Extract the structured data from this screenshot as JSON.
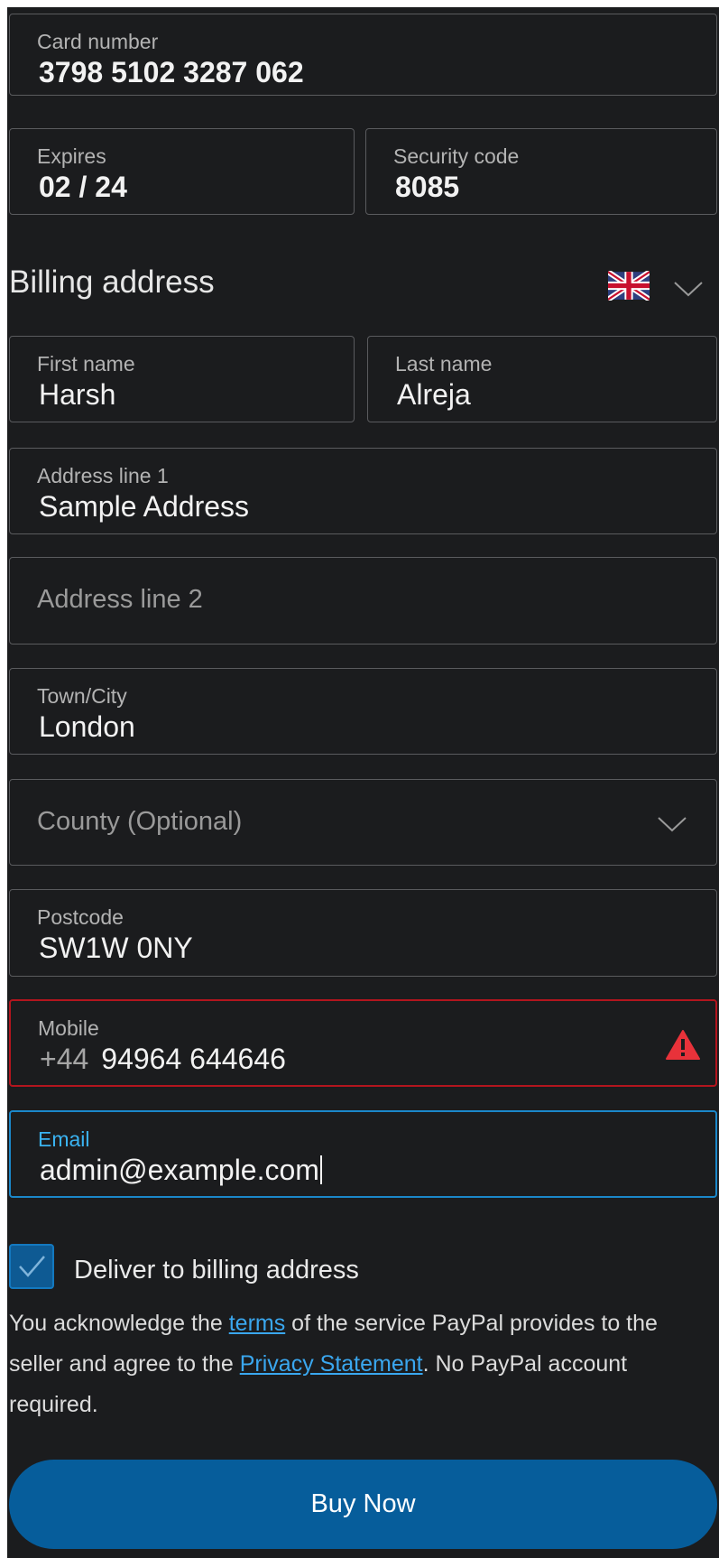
{
  "card": {
    "number_label": "Card number",
    "number_value": "3798 5102 3287 062",
    "expires_label": "Expires",
    "expires_value": "02 / 24",
    "security_label": "Security code",
    "security_value": "8085"
  },
  "billing": {
    "title": "Billing address",
    "country_flag_icon": "uk-flag-icon",
    "first_name_label": "First name",
    "first_name_value": "Harsh",
    "last_name_label": "Last name",
    "last_name_value": "Alreja",
    "address1_label": "Address line 1",
    "address1_value": "Sample Address",
    "address2_placeholder": "Address line 2",
    "city_label": "Town/City",
    "city_value": "London",
    "county_placeholder": "County (Optional)",
    "postcode_label": "Postcode",
    "postcode_value": "SW1W 0NY",
    "mobile_label": "Mobile",
    "mobile_prefix": "+44",
    "mobile_value": "94964 644646",
    "email_label": "Email",
    "email_value": "admin@example.com"
  },
  "delivery": {
    "checkbox_checked": true,
    "label": "Deliver to billing address"
  },
  "legal": {
    "part1": "You acknowledge the ",
    "terms_link": "terms",
    "part2": " of the service PayPal provides to the seller and agree to the ",
    "privacy_link": "Privacy Statement",
    "part3": ". No PayPal account required."
  },
  "actions": {
    "buy_label": "Buy Now"
  },
  "colors": {
    "background": "#1b1c1e",
    "error_border": "#b3151e",
    "focus_border": "#1b87c9",
    "link": "#3aa7ef",
    "primary_button": "#065d9b"
  }
}
